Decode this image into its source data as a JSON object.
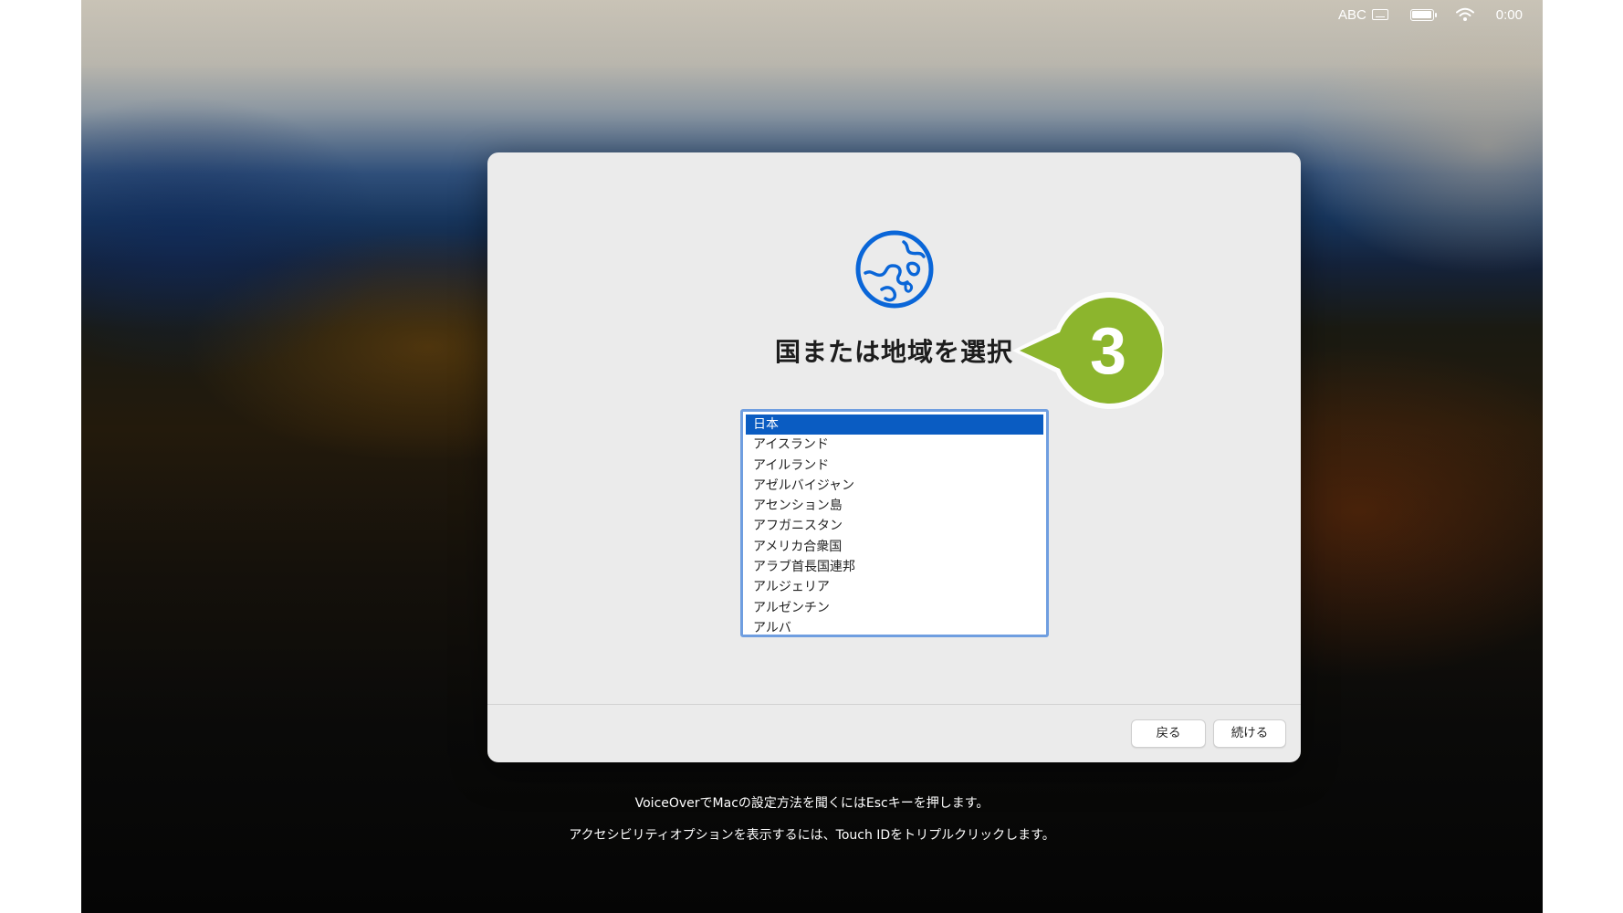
{
  "menubar": {
    "input_source": "ABC",
    "keyboard_icon": "keyboard-icon",
    "battery_icon": "battery-icon",
    "wifi_icon": "wifi-icon",
    "clock": "0:00"
  },
  "dialog": {
    "icon": "globe-icon",
    "title": "国または地域を選択",
    "countries": [
      "日本",
      "アイスランド",
      "アイルランド",
      "アゼルバイジャン",
      "アセンション島",
      "アフガニスタン",
      "アメリカ合衆国",
      "アラブ首長国連邦",
      "アルジェリア",
      "アルゼンチン",
      "アルバ"
    ],
    "selected_country": "日本",
    "back_button": "戻る",
    "continue_button": "続ける"
  },
  "callout": {
    "number": "3",
    "color": "#8cb52d"
  },
  "footer": {
    "voiceover_hint": "VoiceOverでMacの設定方法を聞くにはEscキーを押します。",
    "accessibility_hint": "アクセシビリティオプションを表示するには、Touch IDをトリプルクリックします。"
  },
  "colors": {
    "accent": "#0a5cc2",
    "focus_ring": "#6f9ee0",
    "dialog_bg": "#ebebeb"
  }
}
